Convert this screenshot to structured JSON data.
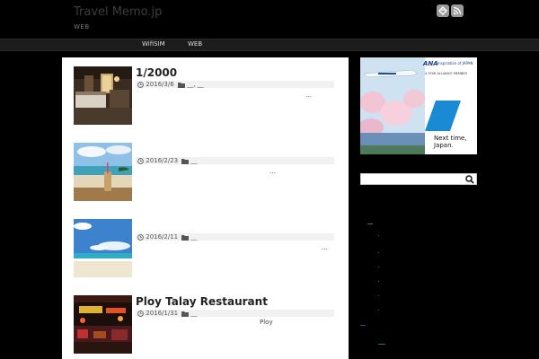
{
  "header": {
    "site_title": "Travel Memo.jp",
    "site_description": "WEB",
    "icons": [
      "feedly-icon",
      "rss-icon"
    ]
  },
  "nav": {
    "items": [
      {
        "label": "WifiSIM"
      },
      {
        "label": "WEB"
      }
    ]
  },
  "posts": [
    {
      "title": "1/2000",
      "date": "2016/3/6",
      "categories": "__, __",
      "excerpt": "…",
      "thumbnail": "hotel-room"
    },
    {
      "title": "",
      "date": "2016/2/23",
      "categories": "__",
      "excerpt": "…",
      "thumbnail": "beach-drink"
    },
    {
      "title": "",
      "date": "2016/2/11",
      "categories": "__",
      "excerpt": "…",
      "thumbnail": "beach"
    },
    {
      "title": "Ploy Talay Restaurant",
      "date": "2016/1/31",
      "categories": "__",
      "excerpt": "Ploy",
      "thumbnail": "night-restaurant"
    }
  ],
  "sidebar": {
    "ad": {
      "brand": "ANA",
      "tagline": "Inspiration of JAPAN",
      "alliance": "A STAR ALLIANCE MEMBER",
      "headline_1": "Next time,",
      "headline_2": "Japan."
    },
    "search": {
      "placeholder": ""
    }
  },
  "colors": {
    "background": "#000000",
    "nav_bg": "#1c1c1c",
    "content_bg": "#ffffff",
    "meta_bg": "#f1f1f1",
    "ad_blue": "#1a8ad4"
  }
}
